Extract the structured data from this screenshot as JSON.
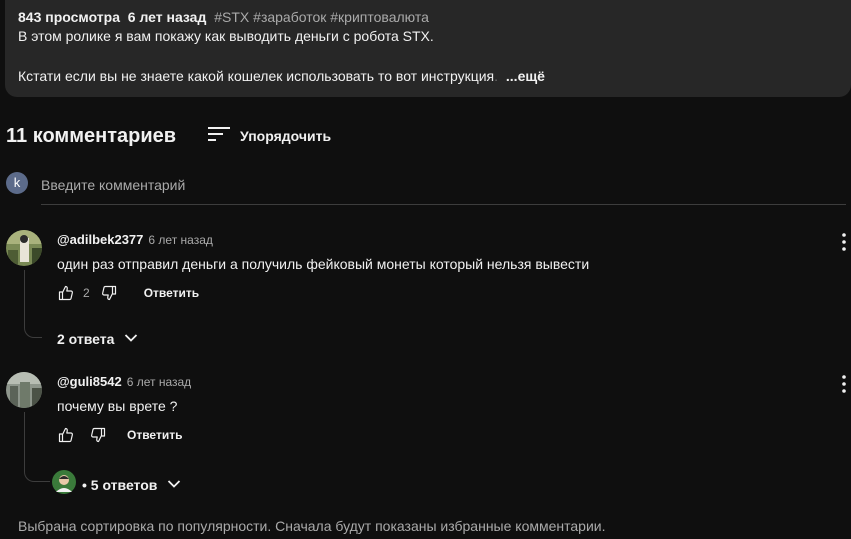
{
  "description": {
    "views": "843 просмотра",
    "age": "6 лет назад",
    "tags": "#STX #заработок #криптовалюта",
    "line1": "В этом ролике я вам покажу как выводить деньги с робота STX.",
    "line2": "Кстати если вы не знаете какой кошелек использовать то вот инструкция",
    "line2_faded": ".",
    "more_label": "...ещё"
  },
  "comments_header": {
    "count": "11 комментариев",
    "sort_label": "Упорядочить"
  },
  "add_comment": {
    "avatar_letter": "k",
    "placeholder": "Введите комментарий"
  },
  "comments": [
    {
      "author": "@adilbek2377",
      "time": "6 лет назад",
      "text": "один раз отправил деньги а получиль фейковый монеты который нельзя вывести",
      "likes": "2",
      "reply_label": "Ответить",
      "replies_label": "2 ответа"
    },
    {
      "author": "@guli8542",
      "time": "6 лет назад",
      "text": "почему вы врете ?",
      "likes": "",
      "reply_label": "Ответить",
      "replies_label": "• 5 ответов"
    }
  ],
  "footer": {
    "note": "Выбрана сортировка по популярности. Сначала будут показаны избранные комментарии."
  },
  "colors": {
    "background": "#0f0f0f",
    "panel": "#272727",
    "text": "#f1f1f1",
    "secondary_text": "#aaaaaa"
  }
}
